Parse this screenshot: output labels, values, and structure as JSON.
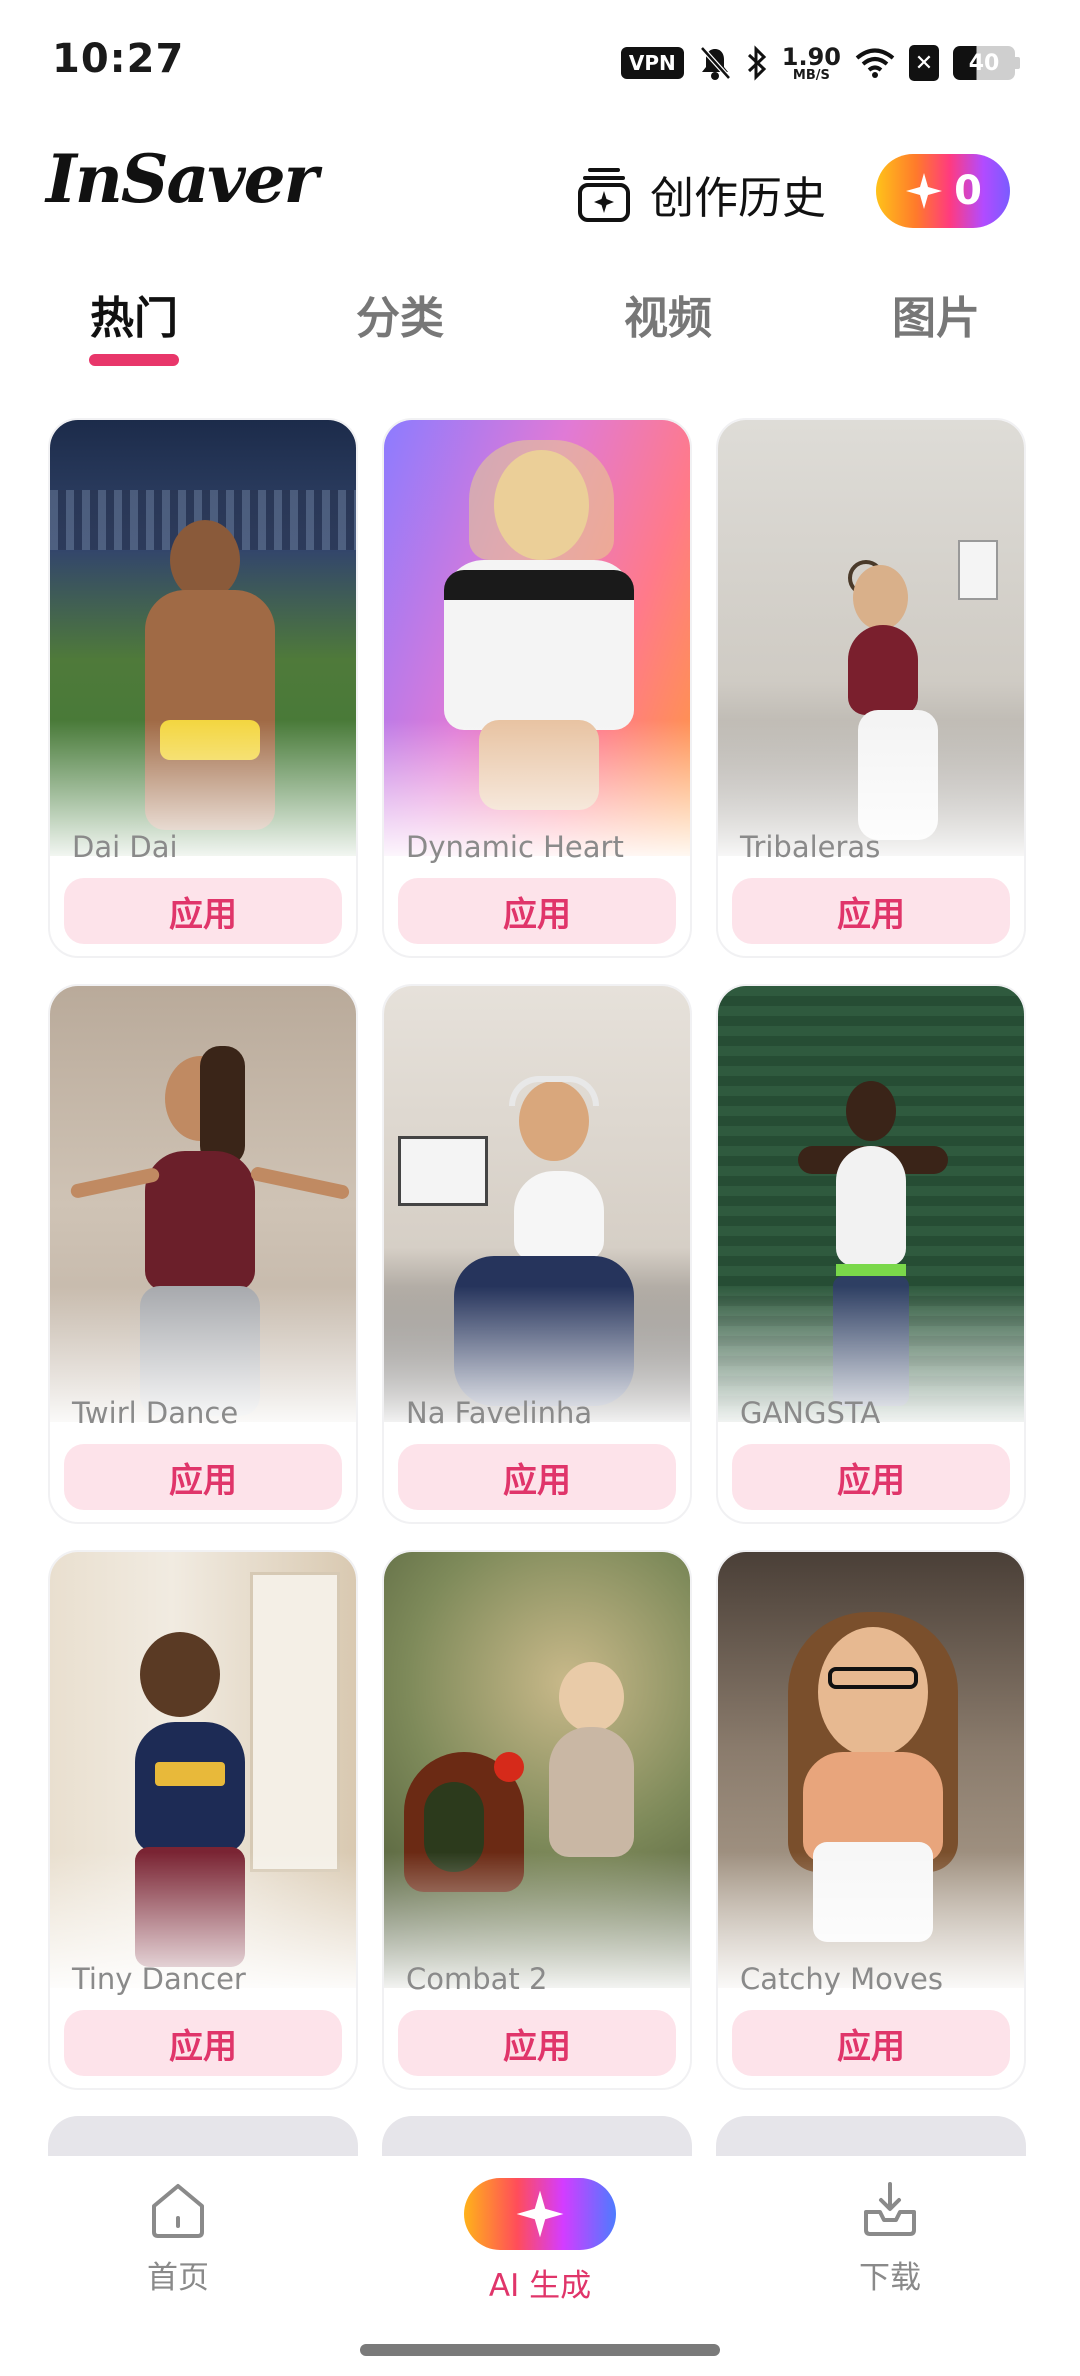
{
  "status_bar": {
    "time": "10:27",
    "vpn": "VPN",
    "speed_value": "1.90",
    "speed_unit": "MB/S",
    "battery": "40"
  },
  "header": {
    "logo": "InSaver",
    "history_label": "创作历史",
    "credits": "0"
  },
  "tabs": [
    "热门",
    "分类",
    "视频",
    "图片"
  ],
  "active_tab": "热门",
  "apply_label": "应用",
  "cards": [
    {
      "title": "Dai Dai",
      "bg": "#3a6b3a"
    },
    {
      "title": "Dynamic Heart",
      "bg": "#c58cff"
    },
    {
      "title": "Tribaleras",
      "bg": "#d8d6d2"
    },
    {
      "title": "Twirl Dance",
      "bg": "#cbbeb2"
    },
    {
      "title": "Na Favelinha",
      "bg": "#d5cfc6"
    },
    {
      "title": "GANGSTA",
      "bg": "#2f5a3e"
    },
    {
      "title": "Tiny Dancer",
      "bg": "#e9dfcf"
    },
    {
      "title": "Combat 2",
      "bg": "#6f7a4a"
    },
    {
      "title": "Catchy Moves",
      "bg": "#9a8a7a"
    }
  ],
  "bottom_nav": {
    "home": "首页",
    "ai": "AI 生成",
    "download": "下载"
  },
  "colors": {
    "accent": "#e0356a",
    "apply_bg": "#fde3ea"
  }
}
